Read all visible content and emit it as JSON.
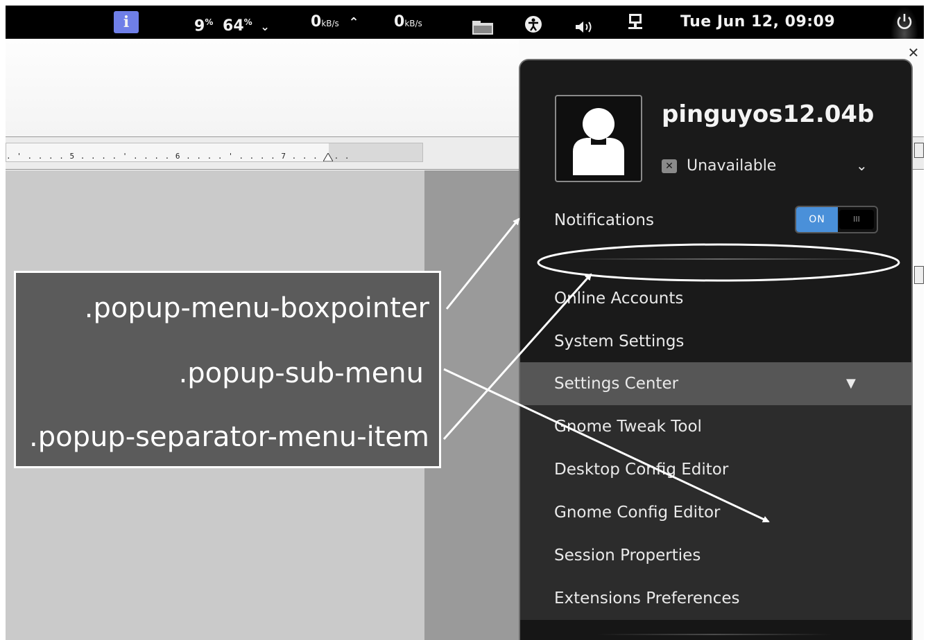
{
  "top_bar": {
    "info_icon_glyph": "i",
    "cpu": "9",
    "cpu_unit": "%",
    "mem": "64",
    "mem_unit": "%",
    "down_value": "0",
    "down_unit": "kB/s",
    "up_value": "0",
    "up_unit": "kB/s",
    "clock": "Tue Jun 12, 09:09",
    "icons": [
      "info-icon",
      "chevron-down-icon",
      "chevron-up-icon",
      "folder-icon",
      "accessibility-icon",
      "volume-icon",
      "network-icon",
      "power-icon"
    ]
  },
  "document": {
    "ruler_ticks": ". ' . . . . 5 . . . . ' . . . . 6 . . . . ' . . . . 7 . . . . . ."
  },
  "user_menu": {
    "username": "pinguyos12.04b",
    "status": "Unavailable",
    "notifications_label": "Notifications",
    "toggle_on": "ON",
    "toggle_off": "III",
    "items": [
      "Online Accounts",
      "System Settings"
    ],
    "submenu_title": "Settings Center",
    "submenu_items": [
      "Gnome Tweak Tool",
      "Desktop Config Editor",
      "Gnome Config Editor",
      "Session Properties",
      "Extensions Preferences"
    ]
  },
  "annotation": {
    "labels": [
      ".popup-menu-boxpointer",
      ".popup-sub-menu",
      ".popup-separator-menu-item"
    ]
  },
  "colors": {
    "toggle_accent": "#4a90d9",
    "menu_bg": "#1a1a1a",
    "submenu_bg": "#2c2c2c",
    "callout_bg": "#5b5b5b"
  }
}
